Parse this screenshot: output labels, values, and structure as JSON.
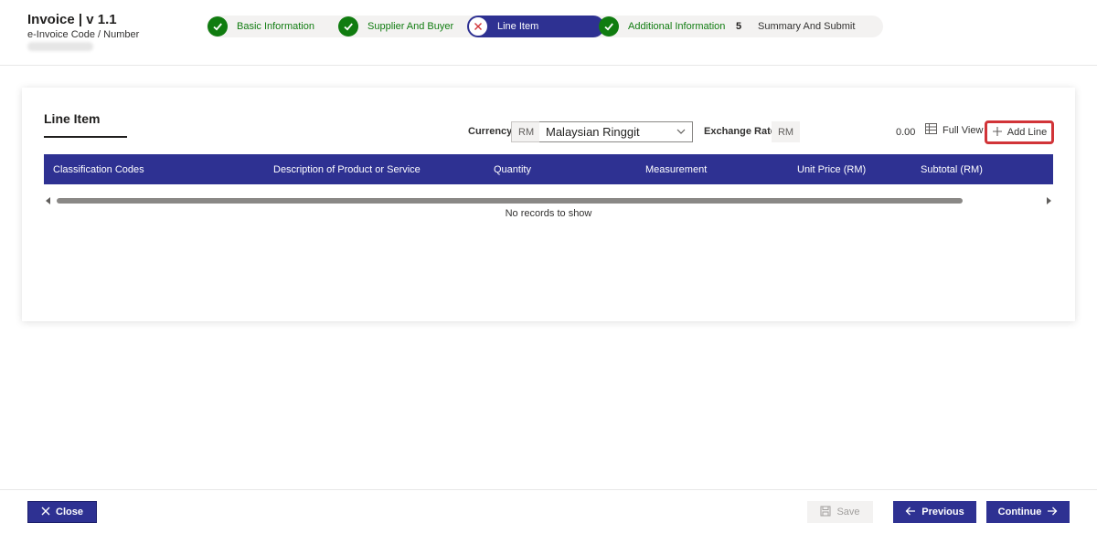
{
  "header": {
    "title": "Invoice | v 1.1",
    "subtitle": "e-Invoice Code / Number"
  },
  "steps": [
    {
      "label": "Basic Information",
      "state": "done"
    },
    {
      "label": "Supplier And Buyer",
      "state": "done"
    },
    {
      "label": "Line Item",
      "state": "active"
    },
    {
      "label": "Additional Information",
      "state": "done"
    },
    {
      "label": "Summary And Submit",
      "state": "pending",
      "number": "5"
    }
  ],
  "card": {
    "title": "Line Item",
    "currency_label": "Currency",
    "currency_prefix": "RM",
    "currency_value": "Malaysian Ringgit",
    "exchange_rate_label": "Exchange Rate",
    "exchange_rate_prefix": "RM",
    "total_value": "0.00",
    "full_view_label": "Full View",
    "add_line_label": "Add Line",
    "columns": [
      "Classification Codes",
      "Description of Product or Service",
      "Quantity",
      "Measurement",
      "Unit Price (RM)",
      "Subtotal (RM)"
    ],
    "empty_text": "No records to show"
  },
  "footer": {
    "close_label": "Close",
    "save_label": "Save",
    "previous_label": "Previous",
    "continue_label": "Continue"
  },
  "colors": {
    "primary": "#2e3192",
    "success": "#107c10",
    "highlight": "#d13438"
  }
}
